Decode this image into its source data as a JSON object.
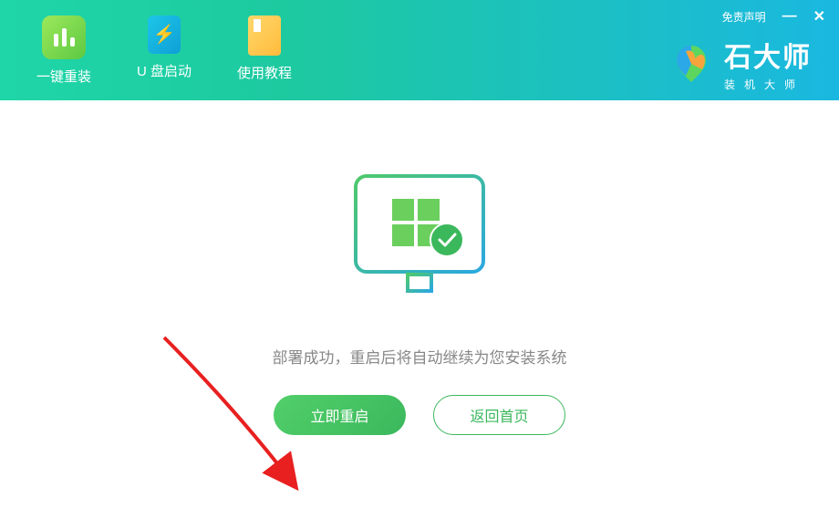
{
  "header": {
    "tabs": [
      {
        "label": "一键重装",
        "active": true
      },
      {
        "label": "U 盘启动",
        "active": false
      },
      {
        "label": "使用教程",
        "active": false
      }
    ],
    "disclaimer": "免责声明"
  },
  "brand": {
    "title": "石大师",
    "subtitle": "装机大师"
  },
  "main": {
    "status_text": "部署成功，重启后将自动继续为您安装系统",
    "restart_button": "立即重启",
    "home_button": "返回首页"
  }
}
